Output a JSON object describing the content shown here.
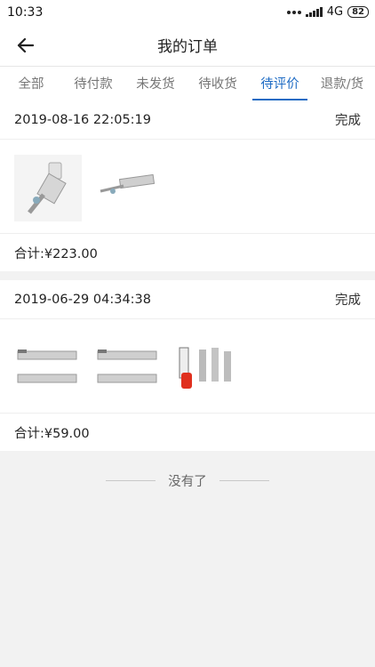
{
  "status_bar": {
    "time": "10:33",
    "network": "4G",
    "battery": "82"
  },
  "header": {
    "title": "我的订单"
  },
  "tabs": [
    {
      "label": "全部",
      "active": false
    },
    {
      "label": "待付款",
      "active": false
    },
    {
      "label": "未发货",
      "active": false
    },
    {
      "label": "待收货",
      "active": false
    },
    {
      "label": "待评价",
      "active": true
    },
    {
      "label": "退款/货",
      "active": false
    }
  ],
  "orders": [
    {
      "datetime": "2019-08-16 22:05:19",
      "status": "完成",
      "total": "合计:¥223.00",
      "items": [
        "lock-pick-tool-product",
        "lock-pick-tool-product"
      ]
    },
    {
      "datetime": "2019-06-29 04:34:38",
      "status": "完成",
      "total": "合计:¥59.00",
      "items": [
        "lock-pick-tool-product",
        "lock-pick-tool-product",
        "lock-pick-set-product"
      ]
    }
  ],
  "footer": {
    "no_more": "没有了"
  },
  "colors": {
    "accent": "#1e6bc4",
    "background": "#f2f2f2"
  }
}
